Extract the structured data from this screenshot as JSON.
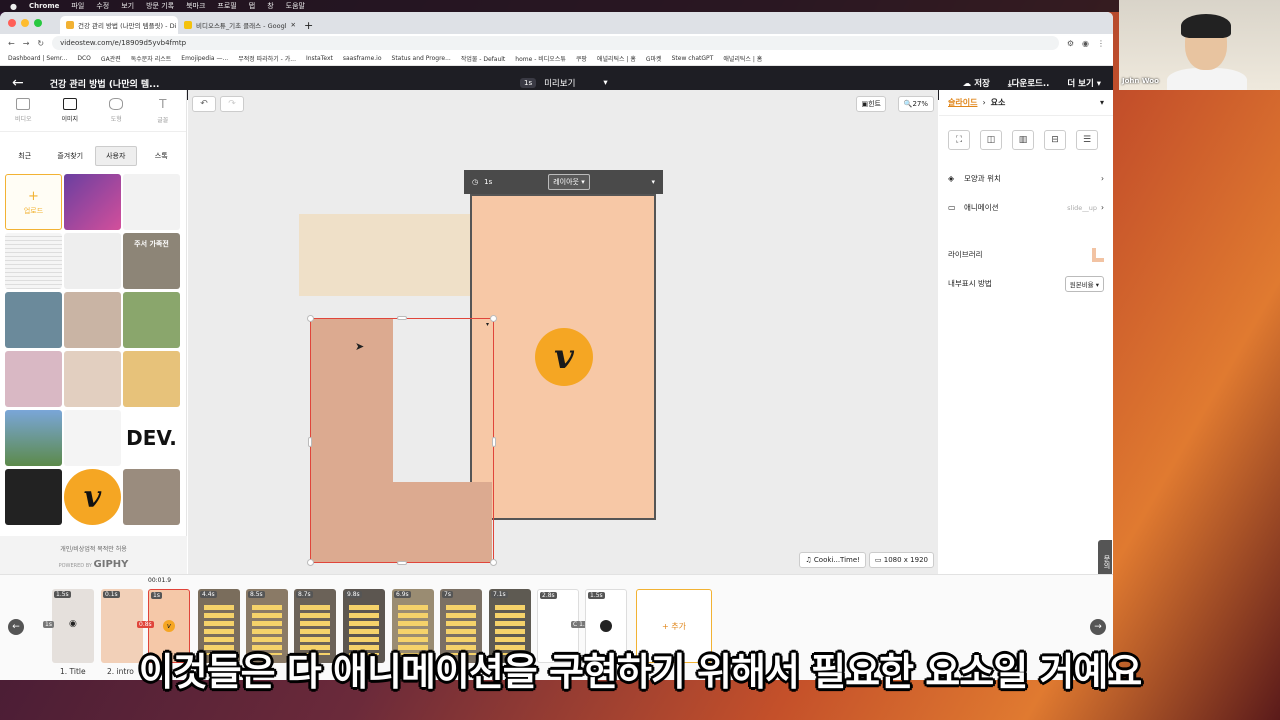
{
  "mac": {
    "app": "Chrome",
    "menus": [
      "파일",
      "수정",
      "보기",
      "방문 기록",
      "북마크",
      "프로필",
      "탭",
      "창",
      "도움말"
    ]
  },
  "browser": {
    "tabs": [
      {
        "label": "건강 관리 방법 (나만의 템플릿) - Di",
        "active": true
      },
      {
        "label": "비디오스튜_기초 클래스 - Googl",
        "active": false
      }
    ],
    "url": "videostew.com/e/18909d5yvb4fmtp",
    "bookmarks": [
      "Dashboard | Semr...",
      "DCO",
      "GA관련",
      "독수문자 리스트",
      "Emojipedia —...",
      "무적정 따라하기 - 가...",
      "InstaText",
      "saasframe.io",
      "Status and Progre...",
      "작업물 - Default",
      "home - 비디오스튜",
      "쿠팡",
      "애널리틱스 | 홈",
      "G마켓",
      "Stew chatGPT",
      "애널리틱스 | 홈"
    ]
  },
  "header": {
    "title": "건강 관리 방법 (나만의 템...",
    "preview_badge": "1s",
    "preview_label": "미리보기",
    "save": "저장",
    "download": "다운로드..",
    "more": "더 보기"
  },
  "left": {
    "categories": [
      {
        "label": "비디오",
        "active": false
      },
      {
        "label": "이미지",
        "active": true
      },
      {
        "label": "도형",
        "active": false
      },
      {
        "label": "글꼴",
        "active": false
      }
    ],
    "subtabs": [
      {
        "label": "최근",
        "active": false
      },
      {
        "label": "즐겨찾기",
        "active": false
      },
      {
        "label": "사용자",
        "active": true
      },
      {
        "label": "스톡",
        "active": false
      }
    ],
    "upload_label": "업로드",
    "upload_plus": "+",
    "grid_texts": {
      "sign": "주서 가족전",
      "dev": "DEV."
    },
    "giphy_note": "개인/비상업적 목적만 허용",
    "giphy_powered": "POWERED BY",
    "giphy_brand": "GIPHY"
  },
  "canvas": {
    "undo": "↶",
    "redo": "↷",
    "hint": "힌트",
    "zoom": "27%",
    "slide_duration": "1s",
    "layout_label": "레이아웃",
    "logo_letter": "v",
    "music": "Cooki...Time!",
    "resolution": "1080 x 1920"
  },
  "right": {
    "crumb_parent": "슬라이드",
    "crumb_current": "요소",
    "rows": {
      "shape_pos": "모양과 위치",
      "animation": "애니메이션",
      "animation_value": "slide__up",
      "library": "라이브러리",
      "display_method": "내부표시 방법",
      "display_value": "원본비율"
    },
    "inquiry": "문의"
  },
  "timeline": {
    "current_time": "00:01.9",
    "thumbs": [
      {
        "dur": "1.5s"
      },
      {
        "dur": "0.1s"
      },
      {
        "dur": "1s"
      },
      {
        "dur": "4.4s"
      },
      {
        "dur": "8.5s"
      },
      {
        "dur": "8.7s"
      },
      {
        "dur": "9.8s"
      },
      {
        "dur": "6.9s"
      },
      {
        "dur": "7s"
      },
      {
        "dur": "7.1s"
      },
      {
        "dur": "2.8s"
      },
      {
        "dur": "1.5s"
      }
    ],
    "inner_badges": {
      "a": "1s",
      "b": "0.8s",
      "c": "C 1.5s"
    },
    "labels": [
      "1. Title",
      "2. intro"
    ],
    "add": "+ 추가"
  },
  "webcam": {
    "name": "John Woo"
  },
  "subtitle": "이것들은 다 애니메이션을 구현하기 위해서 필요한 요소일 거예요",
  "colors": {
    "accent": "#e0861a",
    "selection": "#e0453a",
    "frame": "#f7c8a6",
    "logo": "#f5a623"
  }
}
